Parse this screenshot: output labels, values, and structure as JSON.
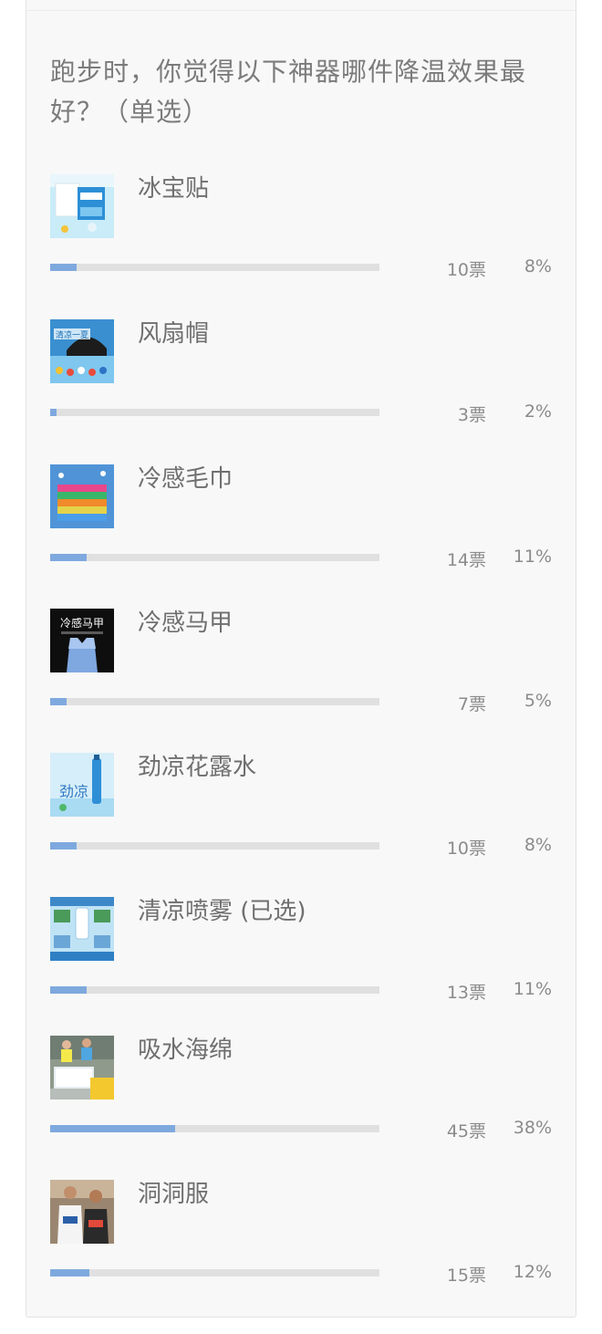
{
  "poll": {
    "question": "跑步时，你觉得以下神器哪件降温效果最好？（单选）",
    "options": [
      {
        "label": "冰宝贴",
        "votes": "10票",
        "percent": "8%",
        "share": 0.08,
        "thumb_text": ""
      },
      {
        "label": "风扇帽",
        "votes": "3票",
        "percent": "2%",
        "share": 0.02,
        "thumb_text": "清凉一夏"
      },
      {
        "label": "冷感毛巾",
        "votes": "14票",
        "percent": "11%",
        "share": 0.11,
        "thumb_text": ""
      },
      {
        "label": "冷感马甲",
        "votes": "7票",
        "percent": "5%",
        "share": 0.05,
        "thumb_text": "冷感马甲"
      },
      {
        "label": "劲凉花露水",
        "votes": "10票",
        "percent": "8%",
        "share": 0.08,
        "thumb_text": "劲凉"
      },
      {
        "label": "清凉喷雾 (已选)",
        "votes": "13票",
        "percent": "11%",
        "share": 0.11,
        "thumb_text": ""
      },
      {
        "label": "吸水海绵",
        "votes": "45票",
        "percent": "38%",
        "share": 0.38,
        "thumb_text": ""
      },
      {
        "label": "洞洞服",
        "votes": "15票",
        "percent": "12%",
        "share": 0.12,
        "thumb_text": ""
      }
    ]
  },
  "colors": {
    "bar_fill": "#7ea9de",
    "bar_track": "#e0e0e0",
    "card_bg": "#f8f8f8"
  }
}
